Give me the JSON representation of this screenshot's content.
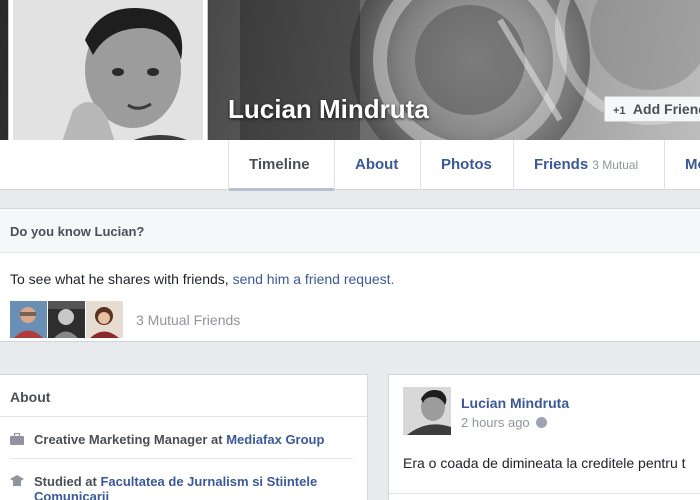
{
  "profile": {
    "name": "Lucian Mindruta",
    "add_friend_label": "Add Friend",
    "add_friend_icon": "add-friend-icon"
  },
  "nav": {
    "tabs": [
      {
        "label": "Timeline",
        "sub": ""
      },
      {
        "label": "About",
        "sub": ""
      },
      {
        "label": "Photos",
        "sub": ""
      },
      {
        "label": "Friends",
        "sub": "3 Mutual"
      },
      {
        "label": "More",
        "sub": ""
      }
    ]
  },
  "know": {
    "heading": "Do you know Lucian?",
    "text_prefix": "To see what he shares with friends,",
    "link": "send him a friend request.",
    "mutual_label": "3 Mutual Friends"
  },
  "about": {
    "heading": "About",
    "work": {
      "prefix": "Creative Marketing Manager at",
      "company": "Mediafax Group",
      "icon": "briefcase-icon"
    },
    "education": {
      "prefix": "Studied at",
      "school": "Facultatea de Jurnalism si Stiintele Comunicarii",
      "icon": "graduation-cap-icon"
    }
  },
  "post": {
    "author": "Lucian Mindruta",
    "time": "2 hours ago",
    "privacy_icon": "globe-icon",
    "text": "Era o coada de dimineata la creditele pentru t"
  },
  "colors": {
    "link": "#3b5998",
    "background": "#e9eaed",
    "muted": "#90949c"
  }
}
